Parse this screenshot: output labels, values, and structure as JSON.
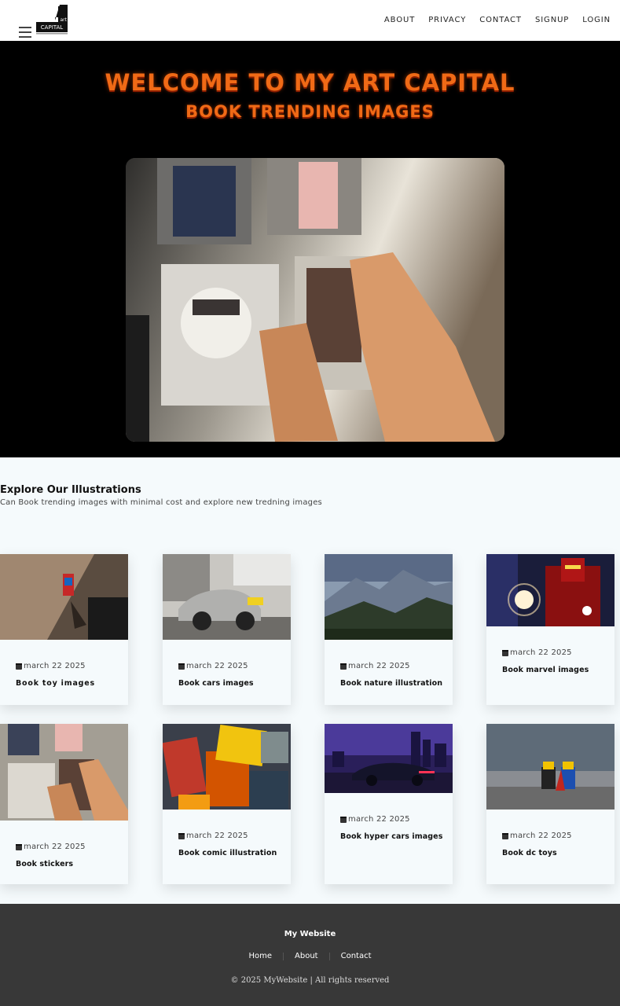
{
  "header": {
    "logo_text_top": "art",
    "logo_text_main": "CAPITAL",
    "nav": [
      "ABOUT",
      "PRIVACY",
      "CONTACT",
      "SIGNUP",
      "LOGIN"
    ]
  },
  "hero": {
    "title": "WELCOME TO MY ART CAPITAL",
    "subtitle": "BOOK TRENDING IMAGES"
  },
  "explore": {
    "title": "Explore Our Illustrations",
    "description": "Can Book trending images with minimal cost and explore new tredning images"
  },
  "cards": [
    {
      "date": "march 22 2025",
      "caption": "Book toy images"
    },
    {
      "date": "march 22 2025",
      "caption": "Book cars images"
    },
    {
      "date": "march 22 2025",
      "caption": "Book nature illustration"
    },
    {
      "date": "march 22 2025",
      "caption": "Book marvel images"
    },
    {
      "date": "march 22 2025",
      "caption": "Book stickers"
    },
    {
      "date": "march 22 2025",
      "caption": "Book comic illustration"
    },
    {
      "date": "march 22 2025",
      "caption": "Book hyper cars images"
    },
    {
      "date": "march 22 2025",
      "caption": "Book dc toys"
    }
  ],
  "footer": {
    "title": "My Website",
    "links": [
      "Home",
      "About",
      "Contact"
    ],
    "copyright": "© 2025 MyWebsite | All rights reserved"
  },
  "colors": {
    "accent": "#f06a16",
    "hero_bg": "#000000",
    "footer_bg": "#383838",
    "page_bg": "#f5fafc"
  }
}
